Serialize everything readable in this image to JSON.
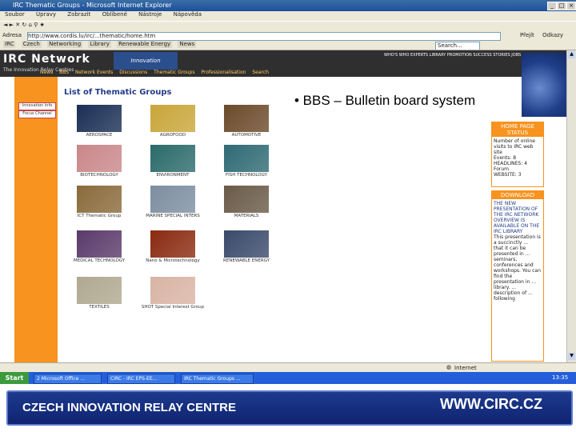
{
  "browser": {
    "title": "IRC Thematic Groups - Microsoft Internet Explorer",
    "menu": [
      "Soubor",
      "Úpravy",
      "Zobrazit",
      "Oblíbené",
      "Nástroje",
      "Nápověda"
    ],
    "address_label": "Adresa",
    "address_value": "http://www.cordis.lu/irc/...thematic/home.htm",
    "go_label": "Přejít",
    "links_label": "Odkazy",
    "links": [
      "IRC",
      "Czech",
      "Networking",
      "Library",
      "Renewable Energy",
      "News"
    ],
    "search_placeholder": "Search..."
  },
  "irc": {
    "logo": "IRC Network",
    "subtitle": "The Innovation Relay Centres",
    "innovation_badge": "Innovation",
    "top_nav": "WHO'S WHO  EXPERTS  LIBRARY  PROMOTION  SUCCESS STORIES  JOBS  HELP",
    "sub_nav": [
      "News",
      "BBS",
      "Network Events",
      "Discussions",
      "Thematic Groups",
      "Professionalisation",
      "Search"
    ],
    "left_buttons": [
      "Innovation Info",
      "Focus Channel"
    ],
    "list_title": "List of Thematic Groups",
    "groups": [
      {
        "label": "AEROSPACE",
        "color": "#1a2f55"
      },
      {
        "label": "AGROFOOD",
        "color": "#c9a63a"
      },
      {
        "label": "AUTOMOTIVE",
        "color": "#6b4a2a"
      },
      {
        "label": "BIOTECHNOLOGY",
        "color": "#c9878a"
      },
      {
        "label": "ENVIRONMENT",
        "color": "#2b6a6a"
      },
      {
        "label": "FISH TECHNOLOGY",
        "color": "#2f6a74"
      },
      {
        "label": "ICT Thematic Group",
        "color": "#8a6a3a"
      },
      {
        "label": "MARINE SPECIAL INTERS",
        "color": "#7d8ea0"
      },
      {
        "label": "MATERIALS",
        "color": "#6a5a48"
      },
      {
        "label": "MEDICAL TECHNOLOGY",
        "color": "#5a3a6a"
      },
      {
        "label": "Nano & Microtechnology",
        "color": "#8a2a10"
      },
      {
        "label": "RENEWABLE ENERGY",
        "color": "#3a4a6a"
      },
      {
        "label": "TEXTILES",
        "color": "#b0a890"
      },
      {
        "label": "SHOT Special Interest Group",
        "color": "#d8b4a4"
      }
    ],
    "panel1": {
      "header": "HOME PAGE STATUS",
      "lines": [
        "Number of online visits to IRC web site",
        "Events: 8",
        "HEADLINES: 4",
        "Forum",
        "WEBSITE: 3"
      ]
    },
    "panel2": {
      "header": "DOWNLOAD",
      "lines": [
        "THE NEW PRESENTATION OF THE IRC NETWORK OVERVIEW IS AVAILABLE ON THE IRC LIBRARY",
        "This presentation is a succinctly ...",
        "that it can be presented in ... seminars, conferences and workshops. You can find the presentation in ... library. ...",
        "description of ... following"
      ]
    }
  },
  "slide": {
    "bullet": "• BBS – Bulletin board system"
  },
  "status": {
    "left": "",
    "zone": "Internet"
  },
  "taskbar": {
    "start": "Start",
    "items": [
      "2 Microsoft Office ...",
      "CIRC - IRC EPS-EE...",
      "IRC Thematic Groups ..."
    ],
    "clock": "13:35"
  },
  "footer": {
    "left": "CZECH INNOVATION RELAY CENTRE",
    "right": "WWW.CIRC.CZ"
  }
}
